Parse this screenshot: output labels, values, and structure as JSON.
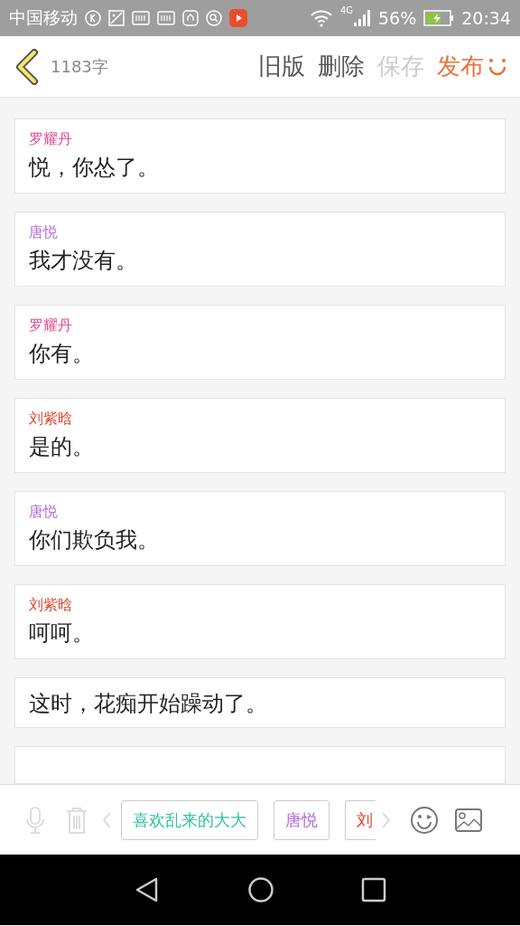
{
  "status_bar": {
    "carrier": "中国移动",
    "network": "4G",
    "battery": "56%",
    "time": "20:34"
  },
  "header": {
    "word_count": "1183字",
    "actions": [
      {
        "label": "旧版",
        "kind": "normal"
      },
      {
        "label": "删除",
        "kind": "normal"
      },
      {
        "label": "保存",
        "kind": "disabled"
      },
      {
        "label": "发布",
        "kind": "primary"
      }
    ]
  },
  "messages": [
    {
      "kind": "dialogue",
      "speaker": "罗耀丹",
      "color": "#e8458b",
      "text": "悦，你怂了。"
    },
    {
      "kind": "dialogue",
      "speaker": "唐悦",
      "color": "#b26ad8",
      "text": "我才没有。"
    },
    {
      "kind": "dialogue",
      "speaker": "罗耀丹",
      "color": "#e8458b",
      "text": "你有。"
    },
    {
      "kind": "dialogue",
      "speaker": "刘紫晗",
      "color": "#e2452f",
      "text": "是的。"
    },
    {
      "kind": "dialogue",
      "speaker": "唐悦",
      "color": "#b26ad8",
      "text": "你们欺负我。"
    },
    {
      "kind": "dialogue",
      "speaker": "刘紫晗",
      "color": "#e2452f",
      "text": "呵呵。"
    },
    {
      "kind": "narration",
      "text": "这时，花痴开始躁动了。"
    },
    {
      "kind": "hidden"
    }
  ],
  "toolbar": {
    "characters": [
      {
        "name": "喜欢乱来的大大",
        "color": "#2ebfa5"
      },
      {
        "name": "唐悦",
        "color": "#b26ad8"
      },
      {
        "name": "刘",
        "color": "#e2452f"
      }
    ]
  }
}
